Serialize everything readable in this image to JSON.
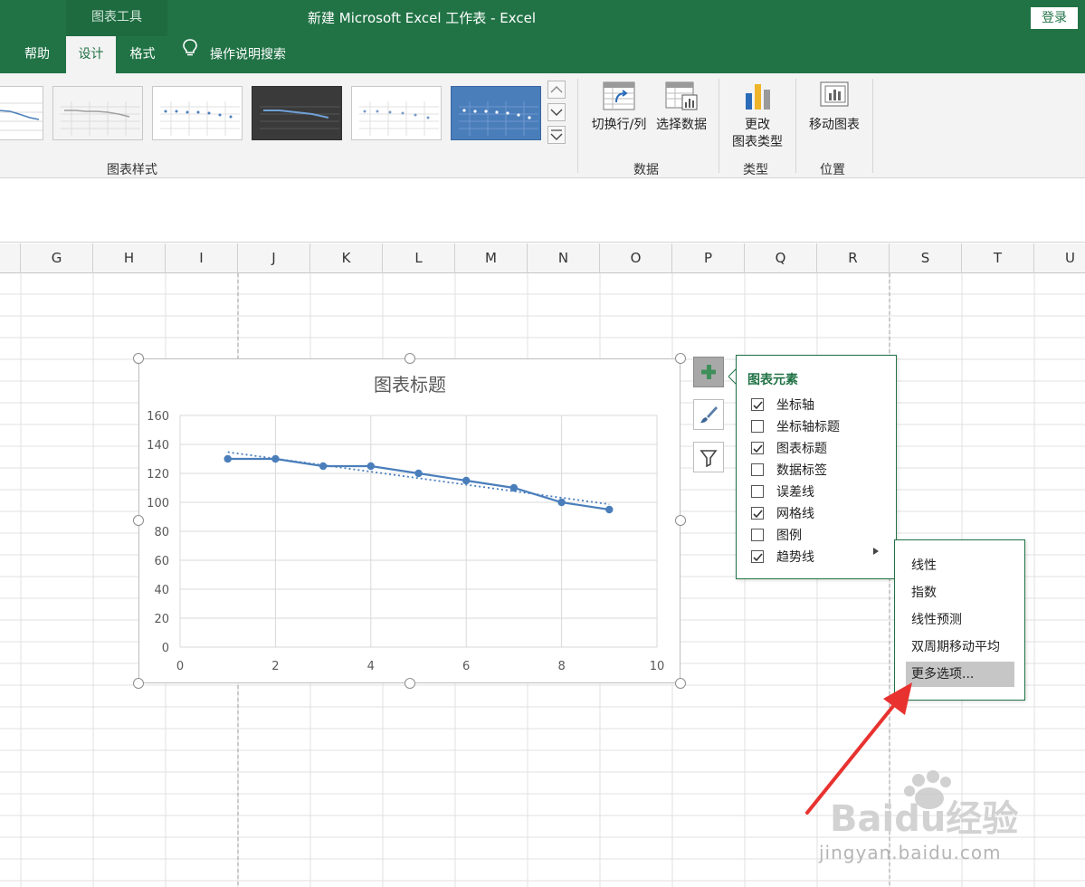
{
  "window": {
    "context_tab": "图表工具",
    "title": "新建 Microsoft Excel 工作表  -  Excel",
    "login": "登录"
  },
  "tabs": [
    {
      "label": "帮助",
      "active": false
    },
    {
      "label": "设计",
      "active": true
    },
    {
      "label": "格式",
      "active": false
    }
  ],
  "search": {
    "label": "操作说明搜索",
    "icon": "lightbulb-icon"
  },
  "ribbon": {
    "groups": {
      "chart_styles": "图表样式",
      "data": "数据",
      "type": "类型",
      "location": "位置"
    },
    "buttons": {
      "switch_row_col": "切换行/列",
      "select_data": "选择数据",
      "change_type_line1": "更改",
      "change_type_line2": "图表类型",
      "move_chart": "移动图表"
    }
  },
  "columns": [
    "G",
    "H",
    "I",
    "J",
    "K",
    "L",
    "M",
    "N",
    "O",
    "P",
    "Q",
    "R",
    "S",
    "T",
    "U"
  ],
  "chart_data": {
    "type": "scatter",
    "title": "图表标题",
    "series": [
      {
        "x": [
          1,
          2,
          3,
          4,
          5,
          6,
          7,
          8,
          9
        ],
        "y": [
          130,
          130,
          125,
          125,
          120,
          115,
          110,
          100,
          95
        ]
      }
    ],
    "trendline": {
      "type": "linear",
      "style": "dotted"
    },
    "xlim": [
      0,
      10
    ],
    "ylim": [
      0,
      160
    ],
    "xticks": [
      0,
      2,
      4,
      6,
      8,
      10
    ],
    "yticks": [
      0,
      20,
      40,
      60,
      80,
      100,
      120,
      140,
      160
    ],
    "grid": true,
    "line_color": "#4a7ebb"
  },
  "chart_elements": {
    "title": "图表元素",
    "options": [
      {
        "label": "坐标轴",
        "checked": true
      },
      {
        "label": "坐标轴标题",
        "checked": false
      },
      {
        "label": "图表标题",
        "checked": true
      },
      {
        "label": "数据标签",
        "checked": false
      },
      {
        "label": "误差线",
        "checked": false
      },
      {
        "label": "网格线",
        "checked": true
      },
      {
        "label": "图例",
        "checked": false
      },
      {
        "label": "趋势线",
        "checked": true
      }
    ]
  },
  "trendline_menu": [
    "线性",
    "指数",
    "线性预测",
    "双周期移动平均",
    "更多选项..."
  ],
  "watermark": {
    "brand": "Baidu经验",
    "url": "jingyan.baidu.com"
  },
  "colors": {
    "excel_green": "#217346",
    "annotation_red": "#e8322f"
  }
}
